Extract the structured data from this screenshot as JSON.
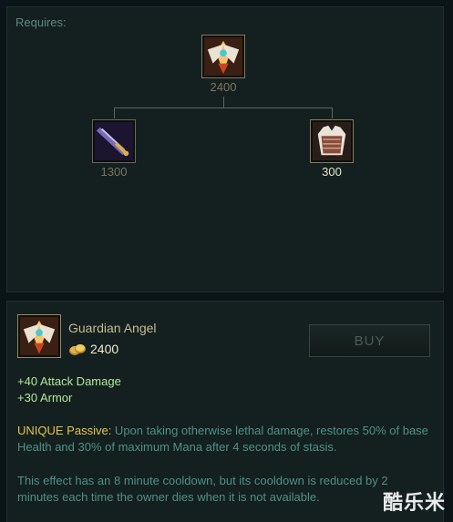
{
  "requires": {
    "label": "Requires:",
    "root": {
      "icon": "guardian-angel-icon",
      "price": "2400"
    },
    "components": [
      {
        "icon": "bf-sword-icon",
        "price": "1300",
        "owned": false
      },
      {
        "icon": "chain-vest-icon",
        "price": "300",
        "owned": true
      }
    ]
  },
  "item": {
    "icon": "guardian-angel-icon",
    "name": "Guardian Angel",
    "cost": "2400",
    "buy_label": "BUY",
    "stats": [
      "+40 Attack Damage",
      "+30 Armor"
    ],
    "passive_label": "UNIQUE Passive:",
    "passive_text": " Upon taking otherwise lethal damage, restores 50% of base Health and 30% of maximum Mana after 4 seconds of stasis.",
    "note": "This effect has an 8 minute cooldown, but its cooldown is reduced by 2 minutes each time the owner dies when it is not available."
  },
  "watermark": "酷乐米",
  "colors": {
    "gold": "#e7c24f",
    "stat_green": "#b6e59a",
    "desc_teal": "#4f8f87"
  }
}
